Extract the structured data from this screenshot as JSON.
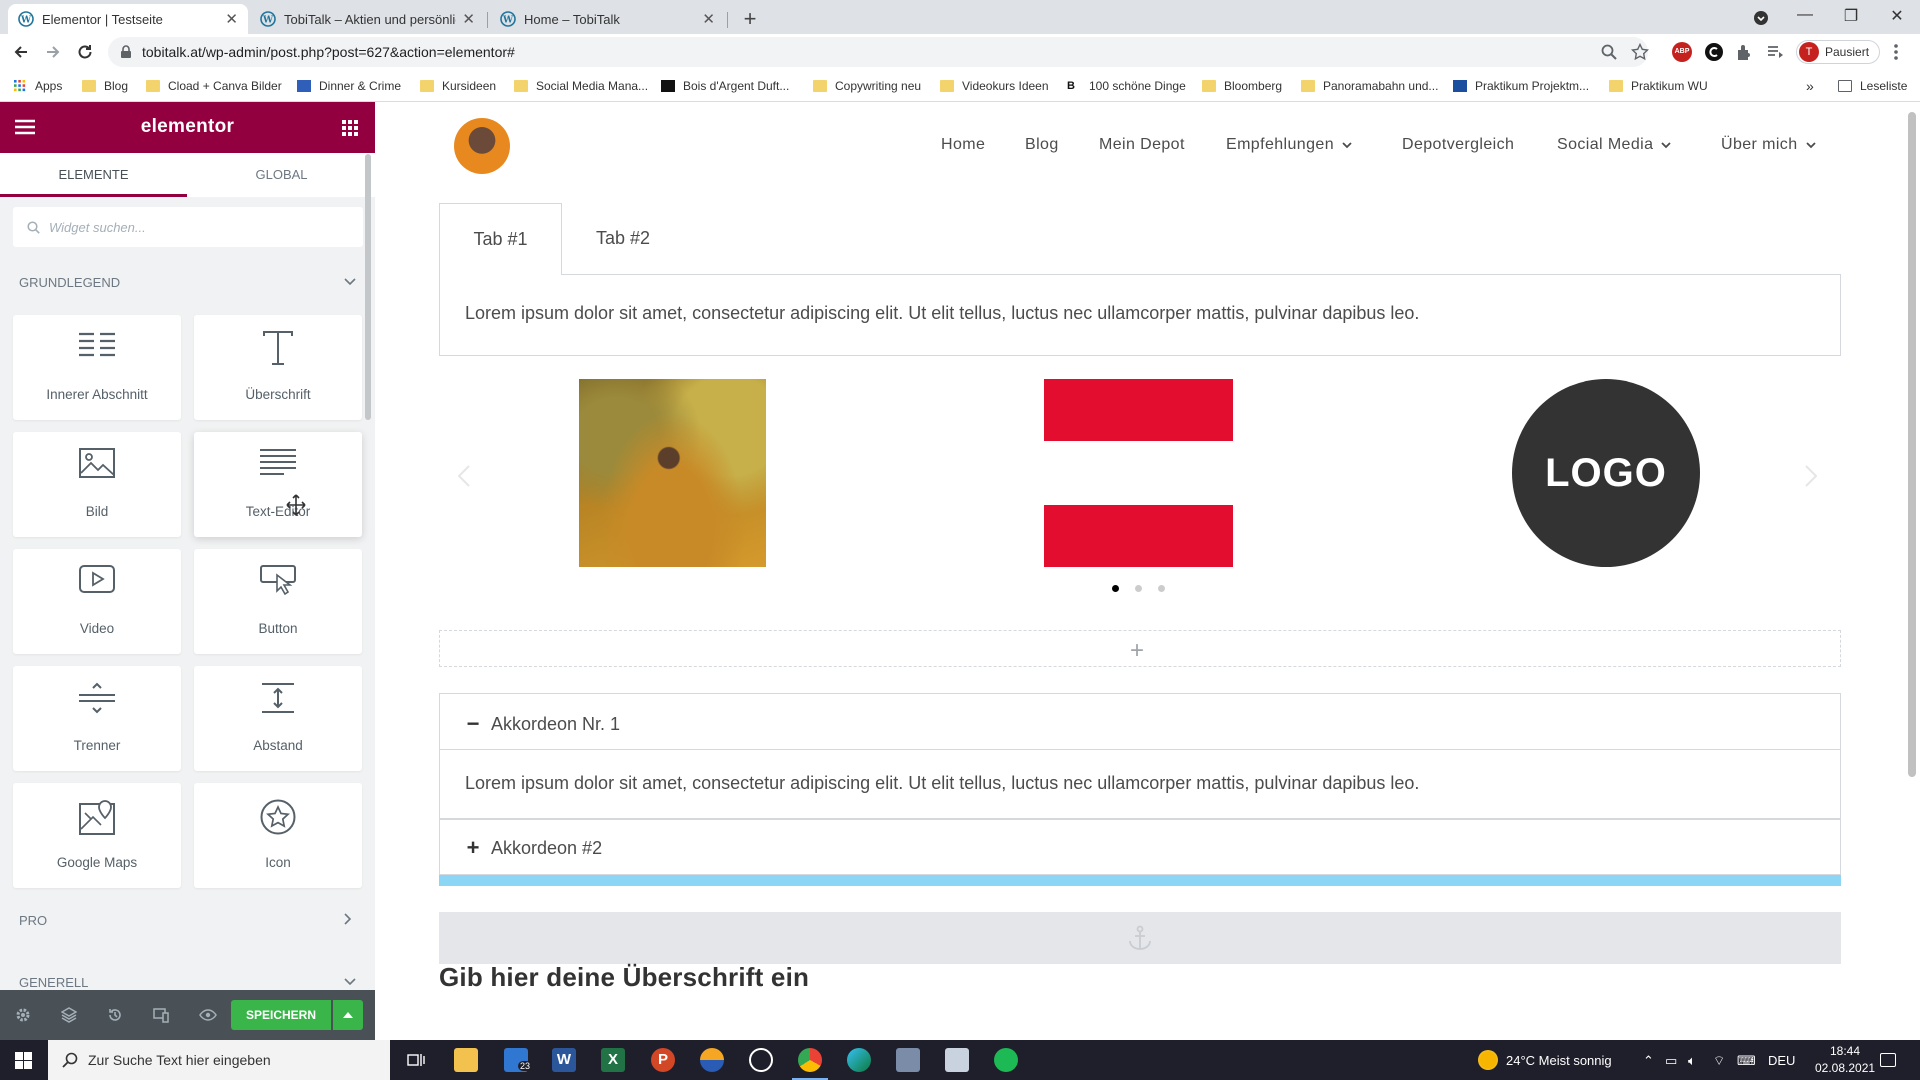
{
  "browser": {
    "tabs": [
      {
        "title": "Elementor | Testseite",
        "active": true
      },
      {
        "title": "TobiTalk – Aktien und persönlich",
        "active": false
      },
      {
        "title": "Home – TobiTalk",
        "active": false
      }
    ],
    "url": "tobitalk.at/wp-admin/post.php?post=627&action=elementor#",
    "profile_label": "Pausiert",
    "profile_initial": "T",
    "bookmarks": [
      "Apps",
      "Blog",
      "Cload + Canva Bilder",
      "Dinner & Crime",
      "Kursideen",
      "Social Media Mana...",
      "Bois d'Argent Duft...",
      "Copywriting neu",
      "Videokurs Ideen",
      "100 schöne Dinge",
      "Bloomberg",
      "Panoramabahn und...",
      "Praktikum Projektm...",
      "Praktikum WU"
    ],
    "reading_list": "Leseliste"
  },
  "panel": {
    "brand": "elementor",
    "tabs": [
      "ELEMENTE",
      "GLOBAL"
    ],
    "search_placeholder": "Widget suchen...",
    "categories": {
      "basic": "GRUNDLEGEND",
      "pro": "PRO",
      "general": "GENERELL"
    },
    "widgets": [
      {
        "label": "Innerer Abschnitt",
        "icon": "inner-section-icon"
      },
      {
        "label": "Überschrift",
        "icon": "heading-icon"
      },
      {
        "label": "Bild",
        "icon": "image-icon"
      },
      {
        "label": "Text-Editor",
        "icon": "text-editor-icon"
      },
      {
        "label": "Video",
        "icon": "video-icon"
      },
      {
        "label": "Button",
        "icon": "button-icon"
      },
      {
        "label": "Trenner",
        "icon": "divider-icon"
      },
      {
        "label": "Abstand",
        "icon": "spacer-icon"
      },
      {
        "label": "Google Maps",
        "icon": "map-icon"
      },
      {
        "label": "Icon",
        "icon": "star-icon"
      }
    ],
    "save_label": "SPEICHERN"
  },
  "preview": {
    "nav": [
      "Home",
      "Blog",
      "Mein Depot",
      "Empfehlungen",
      "Depotvergleich",
      "Social Media",
      "Über mich"
    ],
    "tabs": [
      "Tab #1",
      "Tab #2"
    ],
    "tab_content": "Lorem ipsum dolor sit amet, consectetur adipiscing elit. Ut elit tellus, luctus nec ullamcorper mattis, pulvinar dapibus leo.",
    "logo_text": "LOGO",
    "accordion": [
      {
        "title": "Akkordeon Nr. 1",
        "symbol": "−",
        "body": "Lorem ipsum dolor sit amet, consectetur adipiscing elit. Ut elit tellus, luctus nec ullamcorper mattis, pulvinar dapibus leo."
      },
      {
        "title": "Akkordeon #2",
        "symbol": "+"
      }
    ],
    "heading": "Gib hier deine Überschrift ein"
  },
  "taskbar": {
    "search_placeholder": "Zur Suche Text hier eingeben",
    "mail_badge": "23",
    "weather": "24°C  Meist sonnig",
    "lang": "DEU",
    "time": "18:44",
    "date": "02.08.2021"
  },
  "colors": {
    "elementor_brand": "#93003f",
    "save_green": "#39b54a",
    "slide_red": "#e30d2f",
    "accordion_cyan": "#8dd5f4"
  }
}
